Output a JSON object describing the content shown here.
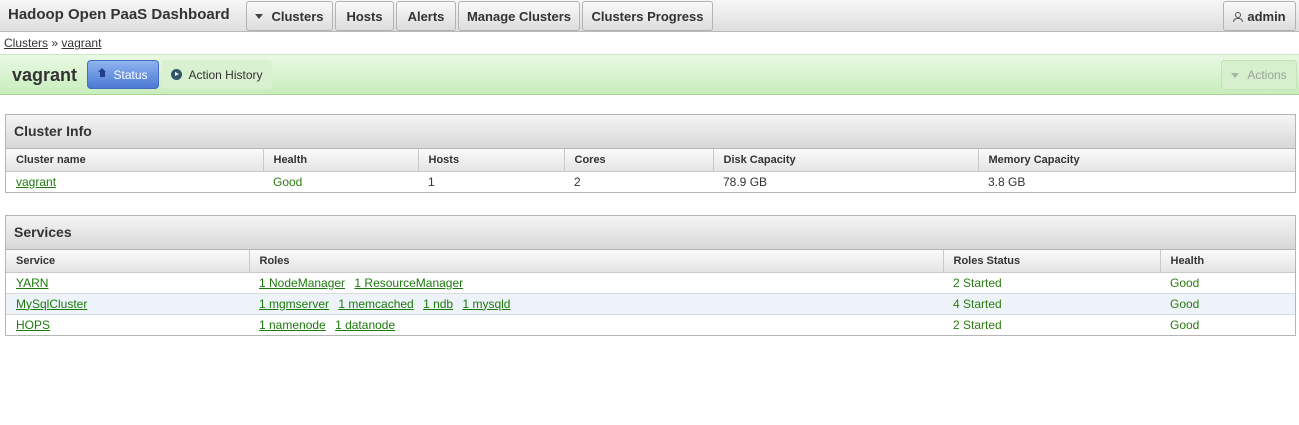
{
  "navbar": {
    "brand": "Hadoop Open PaaS Dashboard",
    "items": [
      {
        "label": "Clusters"
      },
      {
        "label": "Hosts"
      },
      {
        "label": "Alerts"
      },
      {
        "label": "Manage Clusters"
      },
      {
        "label": "Clusters Progress"
      }
    ],
    "user": "admin"
  },
  "breadcrumb": {
    "root": "Clusters",
    "separator": "»",
    "current": "vagrant"
  },
  "cluster": {
    "title": "vagrant",
    "tab_status": "Status",
    "tab_history": "Action History",
    "actions": "Actions"
  },
  "cluster_info": {
    "title": "Cluster Info",
    "columns": [
      "Cluster name",
      "Health",
      "Hosts",
      "Cores",
      "Disk Capacity",
      "Memory Capacity"
    ],
    "row": {
      "name": "vagrant",
      "health": "Good",
      "hosts": "1",
      "cores": "2",
      "disk": "78.9 GB",
      "memory": "3.8 GB"
    }
  },
  "services": {
    "title": "Services",
    "columns": [
      "Service",
      "Roles",
      "Roles Status",
      "Health"
    ],
    "rows": [
      {
        "service": "YARN",
        "roles": [
          "1 NodeManager",
          "1 ResourceManager"
        ],
        "status": "2 Started",
        "health": "Good"
      },
      {
        "service": "MySqlCluster",
        "roles": [
          "1 mgmserver",
          "1 memcached",
          "1 ndb",
          "1 mysqld"
        ],
        "status": "4 Started",
        "health": "Good"
      },
      {
        "service": "HOPS",
        "roles": [
          "1 namenode",
          "1 datanode"
        ],
        "status": "2 Started",
        "health": "Good"
      }
    ]
  },
  "colors": {
    "link_green": "#1c7a0c",
    "status_blue": "#4b79d4",
    "header_green": "#c9edbd"
  }
}
